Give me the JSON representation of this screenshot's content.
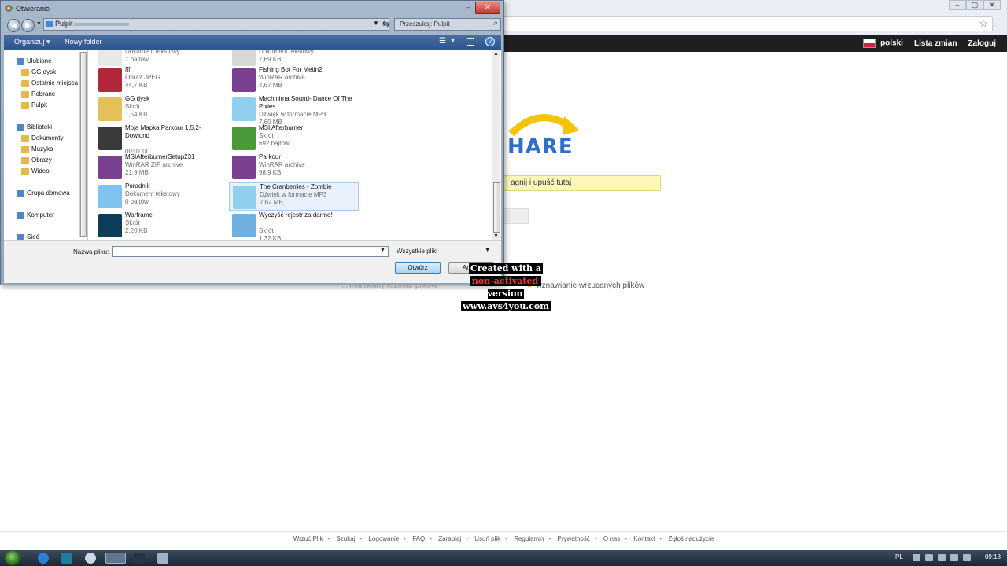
{
  "browser": {
    "window_controls": [
      "–",
      "▢",
      "✕"
    ],
    "site_nav": {
      "language": "polski",
      "changelog": "Lista zmian",
      "login": "Zaloguj"
    },
    "logo_text": "HARE",
    "drop_hint": "agnij i upuść tutaj",
    "feature_text": "wznawianie wrzucanych plików",
    "feature_text_left": "...limitowany rozmiar plików",
    "footer_links": [
      "Wrzuć Plik",
      "Szukaj",
      "Logowanie",
      "FAQ",
      "Zarabiaj",
      "Usuń plik",
      "Regulamin",
      "Prywatność",
      "O nas",
      "Kontakt",
      "Zgłoś nadużycie"
    ]
  },
  "dialog": {
    "title": "Otwieranie",
    "address": "Pulpit",
    "search_placeholder": "Przeszukaj: Pulpit",
    "toolbar": {
      "organize": "Organizuj ▾",
      "new_folder": "Nowy folder"
    },
    "nav_items": [
      {
        "label": "Ulubione",
        "level": 0,
        "icon": "star-icon"
      },
      {
        "label": "GG dysk",
        "level": 1,
        "icon": "folder-icon"
      },
      {
        "label": "Ostatnie miejsca",
        "level": 1,
        "icon": "recent-icon"
      },
      {
        "label": "Pobrane",
        "level": 1,
        "icon": "download-icon"
      },
      {
        "label": "Pulpit",
        "level": 1,
        "icon": "desktop-icon"
      },
      {
        "label": "Biblioteki",
        "level": 0,
        "icon": "library-icon"
      },
      {
        "label": "Dokumenty",
        "level": 1,
        "icon": "documents-icon"
      },
      {
        "label": "Muzyka",
        "level": 1,
        "icon": "music-icon"
      },
      {
        "label": "Obrazy",
        "level": 1,
        "icon": "pictures-icon"
      },
      {
        "label": "Wideo",
        "level": 1,
        "icon": "video-icon"
      },
      {
        "label": "Grupa domowa",
        "level": 0,
        "icon": "homegroup-icon"
      },
      {
        "label": "Komputer",
        "level": 0,
        "icon": "computer-icon"
      },
      {
        "label": "Sieć",
        "level": 0,
        "icon": "network-icon"
      }
    ],
    "files_left": [
      {
        "name": "",
        "type": "Dokument tekstowy",
        "size": "7 bajtów",
        "icon": "text-doc-icon",
        "color": "#e8e8e8"
      },
      {
        "name": "fff",
        "type": "Obraz JPEG",
        "size": "44,7 KB",
        "icon": "image-icon",
        "color": "#b0283a"
      },
      {
        "name": "GG dysk",
        "type": "Skrót",
        "size": "1,54 KB",
        "icon": "gg-folder-icon",
        "color": "#e3c05a"
      },
      {
        "name": "Moja Mapka Parkour 1.5.2- Dowlond",
        "type": "",
        "size": "00:01:00",
        "icon": "video-file-icon",
        "color": "#3a3a3a"
      },
      {
        "name": "MSIAfterburnerSetup231",
        "type": "WinRAR ZIP archive",
        "size": "21,9 MB",
        "icon": "winrar-icon",
        "color": "#7a3f8f"
      },
      {
        "name": "Poradnik",
        "type": "Dokument tekstowy",
        "size": "0 bajtów",
        "icon": "notepad-icon",
        "color": "#7fc3ee"
      },
      {
        "name": "Warframe",
        "type": "Skrót",
        "size": "2,20 KB",
        "icon": "warframe-icon",
        "color": "#0e3d5c"
      }
    ],
    "files_right": [
      {
        "name": "",
        "type": "Dokument tekstowy",
        "size": "7,69 KB",
        "icon": "doc-icon",
        "color": "#d8d8d8",
        "selected": false
      },
      {
        "name": "Fishing Bot For Metin2",
        "type": "WinRAR archive",
        "size": "4,67 MB",
        "icon": "winrar-icon",
        "color": "#7a3f8f",
        "selected": false
      },
      {
        "name": "Machinima Sound- Dance Of The Pixies",
        "type": "Dźwięk w formacie MP3",
        "size": "7,60 MB",
        "icon": "mp3-icon",
        "color": "#8fd0ee",
        "selected": false
      },
      {
        "name": "MSI Afterburner",
        "type": "Skrót",
        "size": "692 bajtów",
        "icon": "afterburner-icon",
        "color": "#4a9a3a",
        "selected": false
      },
      {
        "name": "Parkour",
        "type": "WinRAR archive",
        "size": "98,9 KB",
        "icon": "winrar-icon",
        "color": "#7a3f8f",
        "selected": false
      },
      {
        "name": "The Cranberries - Zombie",
        "type": "Dźwięk w formacie MP3",
        "size": "7,62 MB",
        "icon": "mp3-icon",
        "color": "#8fd0ee",
        "selected": true
      },
      {
        "name": "Wyczyść rejestr za darmo!",
        "type": "Skrót",
        "size": "1,32 KB",
        "icon": "registry-cleaner-icon",
        "color": "#6fb0e0",
        "selected": false
      }
    ],
    "filename_label": "Nazwa pliku:",
    "filename_value": "",
    "filter": "Wszystkie pliki",
    "open_button": "Otwórz",
    "cancel_button": "Anuluj"
  },
  "watermark": {
    "line1": "Created with a",
    "red": "non-activated",
    "line2_tail": " version",
    "line3": "www.avs4you.com"
  },
  "taskbar": {
    "lang": "PL",
    "clock": "09:18"
  }
}
